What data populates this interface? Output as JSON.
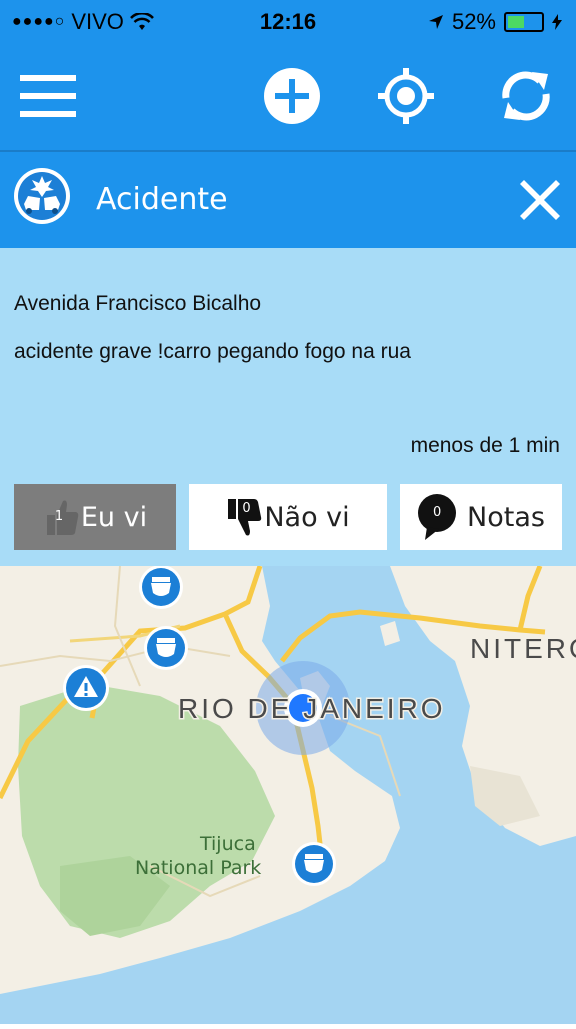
{
  "status_bar": {
    "carrier": "VIVO",
    "time": "12:16",
    "battery": "52%",
    "battery_level": 0.52
  },
  "toolbar": {
    "menu_icon": "menu-icon",
    "add_icon": "plus-circle-icon",
    "locate_icon": "location-target-icon",
    "refresh_icon": "refresh-icon"
  },
  "alert": {
    "type_icon": "accident-icon",
    "title": "Acidente",
    "street": "Avenida Francisco Bicalho",
    "description": "acidente grave !carro pegando fogo na rua",
    "time_ago": "menos de 1 min"
  },
  "actions": {
    "seen": {
      "label": "Eu vi",
      "count": "1"
    },
    "not_seen": {
      "label": "Não vi",
      "count": "0"
    },
    "notes": {
      "label": "Notas",
      "count": "0"
    }
  },
  "map": {
    "city_label": "RIO DE JANEIRO",
    "neighbor_label": "NITERÓ",
    "park_label_1": "Tijuca",
    "park_label_2": "National Park",
    "colors": {
      "water": "#a4d4f2",
      "land": "#f3efe5",
      "park": "#bcdcab",
      "road": "#f7c945",
      "marker": "#1c7fd6"
    }
  }
}
